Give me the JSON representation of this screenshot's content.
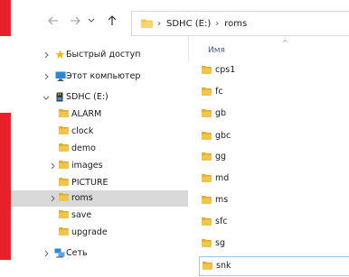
{
  "nav": {
    "back_icon": "back-arrow-icon",
    "forward_icon": "forward-arrow-icon",
    "recent_icon": "chevron-down-icon",
    "up_icon": "up-arrow-icon"
  },
  "address": {
    "segments": [
      "SDHC (E:)",
      "roms"
    ]
  },
  "tree": {
    "quick_access": "Быстрый доступ",
    "this_pc": "Этот компьютер",
    "drive": "SDHC (E:)",
    "folders": [
      "ALARM",
      "clock",
      "demo",
      "images",
      "PICTURE",
      "roms",
      "save",
      "upgrade"
    ],
    "network": "Сеть"
  },
  "content": {
    "column_name": "Имя",
    "files": [
      "cps1",
      "fc",
      "gb",
      "gbc",
      "gg",
      "md",
      "ms",
      "sfc",
      "sg",
      "snk"
    ]
  },
  "colors": {
    "folder": "#f3c44b",
    "folder_dark": "#dcab2f",
    "accent_red": "#e8202a",
    "selection": "#d9d9d9"
  }
}
